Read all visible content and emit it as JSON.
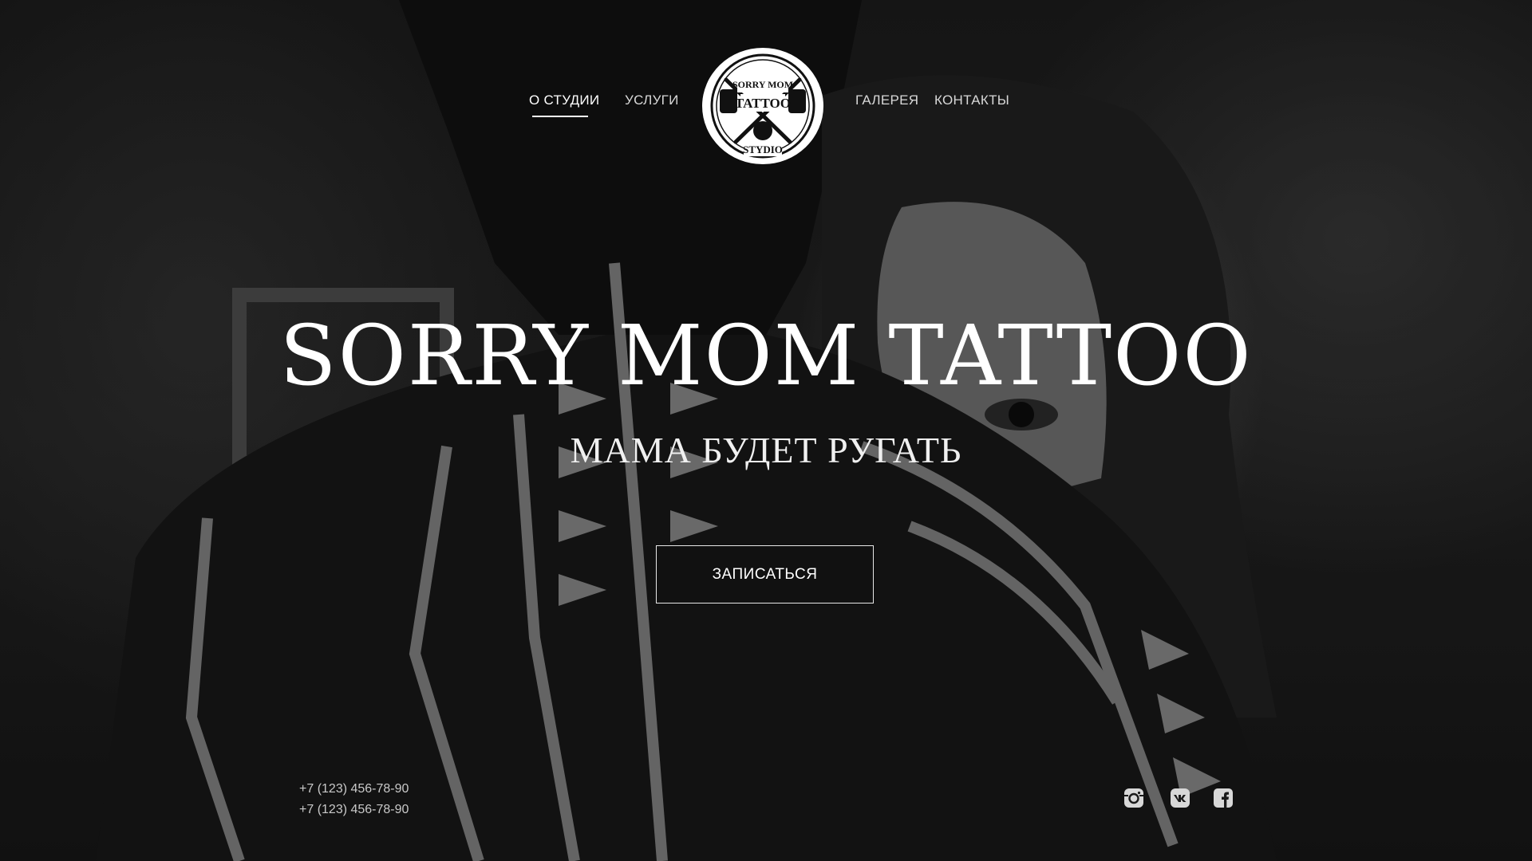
{
  "nav": {
    "items": [
      {
        "label": "О СТУДИИ",
        "active": true
      },
      {
        "label": "УСЛУГИ",
        "active": false
      },
      {
        "label": "ГАЛЕРЕЯ",
        "active": false
      },
      {
        "label": "КОНТАКТЫ",
        "active": false
      }
    ],
    "logo": {
      "text_top": "SORRY MOM",
      "text_middle": "TATTOO",
      "text_bottom": "STYDIO",
      "icon": "crossed-tattoo-machines-icon"
    }
  },
  "hero": {
    "title": "SORRY MOM TATTOO",
    "subtitle": "МАМА БУДЕТ РУГАТЬ",
    "cta_label": "ЗАПИСАТЬСЯ"
  },
  "footer": {
    "phones": [
      "+7 (123) 456-78-90",
      "+7 (123) 456-78-90"
    ],
    "socials": [
      {
        "name": "instagram",
        "icon": "instagram-icon"
      },
      {
        "name": "vk",
        "icon": "vk-icon"
      },
      {
        "name": "facebook",
        "icon": "facebook-icon"
      }
    ]
  },
  "colors": {
    "background": "#141414",
    "text": "#ffffff",
    "muted_text": "#c9c9c9",
    "accent": "#ffffff"
  }
}
